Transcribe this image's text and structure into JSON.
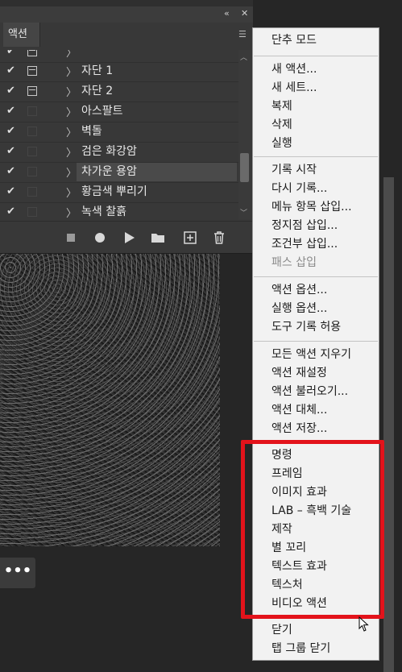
{
  "panel": {
    "tab_label": "액션",
    "collapse_glyph": "«",
    "close_glyph": "✕",
    "menu_glyph": "☰",
    "rows": [
      {
        "label": "",
        "checked": true,
        "dialog": true,
        "selected": false
      },
      {
        "label": "자단 1",
        "checked": true,
        "dialog": true,
        "selected": false
      },
      {
        "label": "자단 2",
        "checked": true,
        "dialog": true,
        "selected": false
      },
      {
        "label": "아스팔트",
        "checked": true,
        "dialog": false,
        "selected": false
      },
      {
        "label": "벽돌",
        "checked": true,
        "dialog": false,
        "selected": false
      },
      {
        "label": "검은 화강암",
        "checked": true,
        "dialog": false,
        "selected": false
      },
      {
        "label": "차가운 용암",
        "checked": true,
        "dialog": false,
        "selected": true
      },
      {
        "label": "황금색 뿌리기",
        "checked": true,
        "dialog": false,
        "selected": false
      },
      {
        "label": "녹색 찰흙",
        "checked": true,
        "dialog": false,
        "selected": false
      }
    ],
    "check_glyph": "✔",
    "chevron_glyph": "〉",
    "toolbar": {
      "stop": "stop-square-icon",
      "record": "record-circle-icon",
      "play": "play-triangle-icon",
      "folder": "folder-icon",
      "new": "new-action-icon",
      "delete": "trash-icon"
    }
  },
  "more_button": "•••",
  "menu": {
    "groups": [
      [
        "단추 모드"
      ],
      [
        "새 액션...",
        "새 세트...",
        "복제",
        "삭제",
        "실행"
      ],
      [
        "기록 시작",
        "다시 기록...",
        "메뉴 항목 삽입...",
        "정지점 삽입...",
        "조건부 삽입...",
        "패스 삽입"
      ],
      [
        "액션 옵션...",
        "실행 옵션...",
        "도구 기록 허용"
      ],
      [
        "모든 액션 지우기",
        "액션 재설정",
        "액션 불러오기...",
        "액션 대체...",
        "액션 저장..."
      ],
      [
        "명령",
        "프레임",
        "이미지 효과",
        "LAB – 흑백 기술",
        "제작",
        "별 꼬리",
        "텍스트 효과",
        "텍스처",
        "비디오 액션"
      ],
      [
        "닫기",
        "탭 그룹 닫기"
      ]
    ],
    "disabled": [
      "패스 삽입"
    ]
  },
  "colors": {
    "highlight": "#e3131b",
    "menu_bg": "#f2f2f2",
    "panel_bg": "#383838"
  }
}
